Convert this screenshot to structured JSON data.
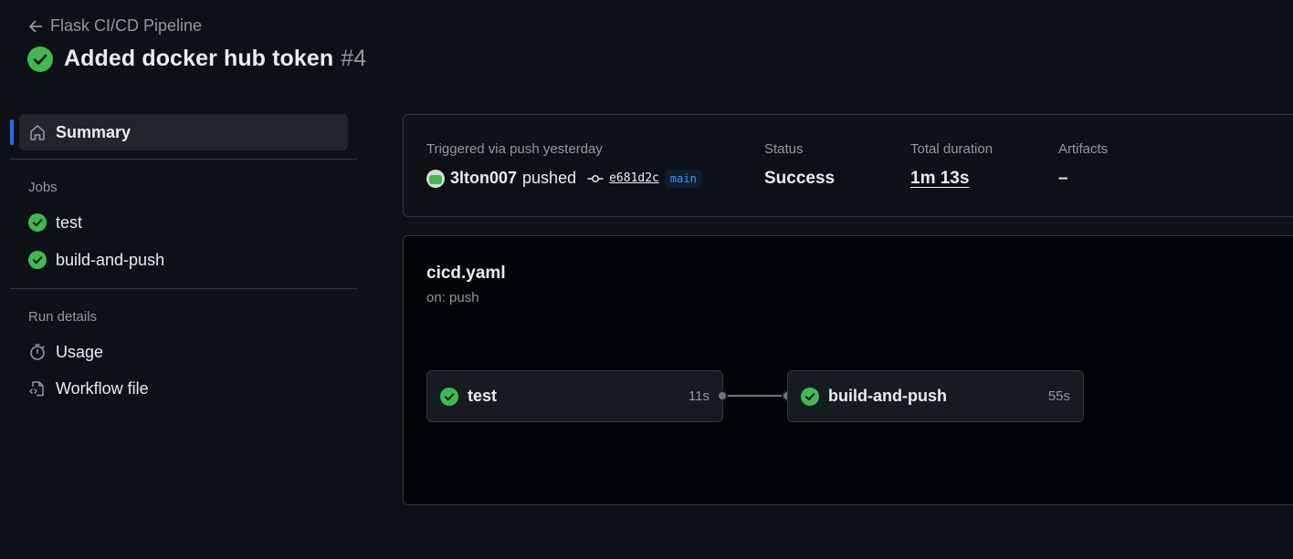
{
  "header": {
    "back_label": "Flask CI/CD Pipeline",
    "title": "Added docker hub token",
    "run_number": "#4"
  },
  "sidebar": {
    "summary_label": "Summary",
    "jobs_heading": "Jobs",
    "jobs": [
      {
        "label": "test",
        "status": "success"
      },
      {
        "label": "build-and-push",
        "status": "success"
      }
    ],
    "run_details_heading": "Run details",
    "run_details": [
      {
        "label": "Usage",
        "icon": "stopwatch-icon"
      },
      {
        "label": "Workflow file",
        "icon": "file-code-icon"
      }
    ]
  },
  "summary": {
    "trigger_label": "Triggered via push yesterday",
    "actor": "3lton007",
    "action": "pushed",
    "commit": "e681d2c",
    "branch": "main",
    "status_label": "Status",
    "status_value": "Success",
    "duration_label": "Total duration",
    "duration_value": "1m 13s",
    "artifacts_label": "Artifacts",
    "artifacts_value": "–"
  },
  "graph": {
    "workflow_file": "cicd.yaml",
    "trigger": "on: push",
    "jobs": [
      {
        "name": "test",
        "duration": "11s"
      },
      {
        "name": "build-and-push",
        "duration": "55s"
      }
    ]
  },
  "colors": {
    "background": "#0d1117",
    "success": "#3fb950",
    "accent": "#1f6feb",
    "muted_text": "#9198a1"
  }
}
